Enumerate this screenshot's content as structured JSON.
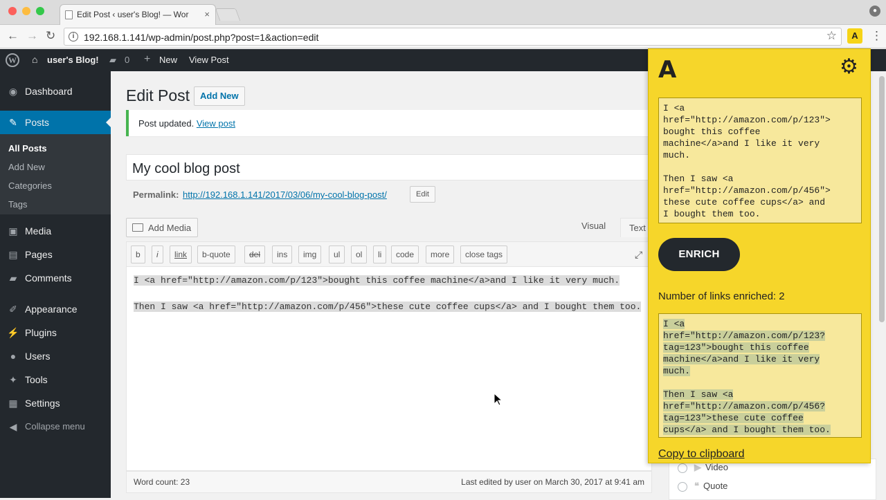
{
  "browser": {
    "tab_title": "Edit Post ‹ user's Blog! — Wor",
    "tab_close": "×",
    "url": "192.168.1.141/wp-admin/post.php?post=1&action=edit",
    "extension_letter": "A",
    "back": "←",
    "forward": "→",
    "reload": "↻",
    "star": "☆",
    "menu": "⋮",
    "info": "i",
    "lights": {
      "red": "#fc605b",
      "yellow": "#fdbc40",
      "green": "#34c84a"
    }
  },
  "adminbar": {
    "site": "user's Blog!",
    "comments": "0",
    "new": "New",
    "view_post": "View Post",
    "plus": "+",
    "wp": "W"
  },
  "sidebar": {
    "items": [
      {
        "label": "Dashboard",
        "icon": "dashboard-icon",
        "glyph": "◉"
      },
      {
        "label": "Posts",
        "icon": "pin-icon",
        "glyph": "✎"
      },
      {
        "label": "Media",
        "icon": "media-icon",
        "glyph": "▣"
      },
      {
        "label": "Pages",
        "icon": "pages-icon",
        "glyph": "▤"
      },
      {
        "label": "Comments",
        "icon": "comment-icon",
        "glyph": "▰"
      },
      {
        "label": "Appearance",
        "icon": "brush-icon",
        "glyph": "✐"
      },
      {
        "label": "Plugins",
        "icon": "plug-icon",
        "glyph": "⚡"
      },
      {
        "label": "Users",
        "icon": "user-icon",
        "glyph": "●"
      },
      {
        "label": "Tools",
        "icon": "wrench-icon",
        "glyph": "✦"
      },
      {
        "label": "Settings",
        "icon": "settings-icon",
        "glyph": "▦"
      },
      {
        "label": "Collapse menu",
        "icon": "collapse-icon",
        "glyph": "◀"
      }
    ],
    "sub_items": [
      "All Posts",
      "Add New",
      "Categories",
      "Tags"
    ]
  },
  "editor": {
    "page_title": "Edit Post",
    "add_new": "Add New",
    "notice_text": "Post updated.",
    "notice_link": "View post",
    "post_title": "My cool blog post",
    "permalink_label": "Permalink:",
    "permalink_url": "http://192.168.1.141/2017/03/06/my-cool-blog-post/",
    "permalink_edit": "Edit",
    "add_media": "Add Media",
    "tab_visual": "Visual",
    "tab_text": "Text",
    "quicktags": [
      "b",
      "i",
      "link",
      "b-quote",
      "del",
      "ins",
      "img",
      "ul",
      "ol",
      "li",
      "code",
      "more",
      "close tags"
    ],
    "content_lines": [
      "I <a href=\"http://amazon.com/p/123\">bought this coffee machine</a>and I like it very much.",
      "Then I saw <a href=\"http://amazon.com/p/456\">these cute coffee cups</a> and I bought them too."
    ],
    "word_count": "Word count: 23",
    "last_edited": "Last edited by user on March 30, 2017 at 9:41 am",
    "formats": [
      "Video",
      "Quote"
    ]
  },
  "popup": {
    "logo": "A",
    "input_text": "I <a\nhref=\"http://amazon.com/p/123\">\nbought this coffee\nmachine</a>and I like it very\nmuch.\n\nThen I saw <a\nhref=\"http://amazon.com/p/456\">\nthese cute coffee cups</a> and\nI bought them too.",
    "enrich": "ENRICH",
    "enriched_count": "Number of links enriched: 2",
    "output_text": "I <a\nhref=\"http://amazon.com/p/123?\ntag=123\">bought this coffee\nmachine</a>and I like it very\nmuch.\n\nThen I saw <a\nhref=\"http://amazon.com/p/456?\ntag=123\">these cute coffee\ncups</a> and I bought them too.",
    "copy": "Copy to clipboard",
    "accent": "#f6d62a"
  }
}
